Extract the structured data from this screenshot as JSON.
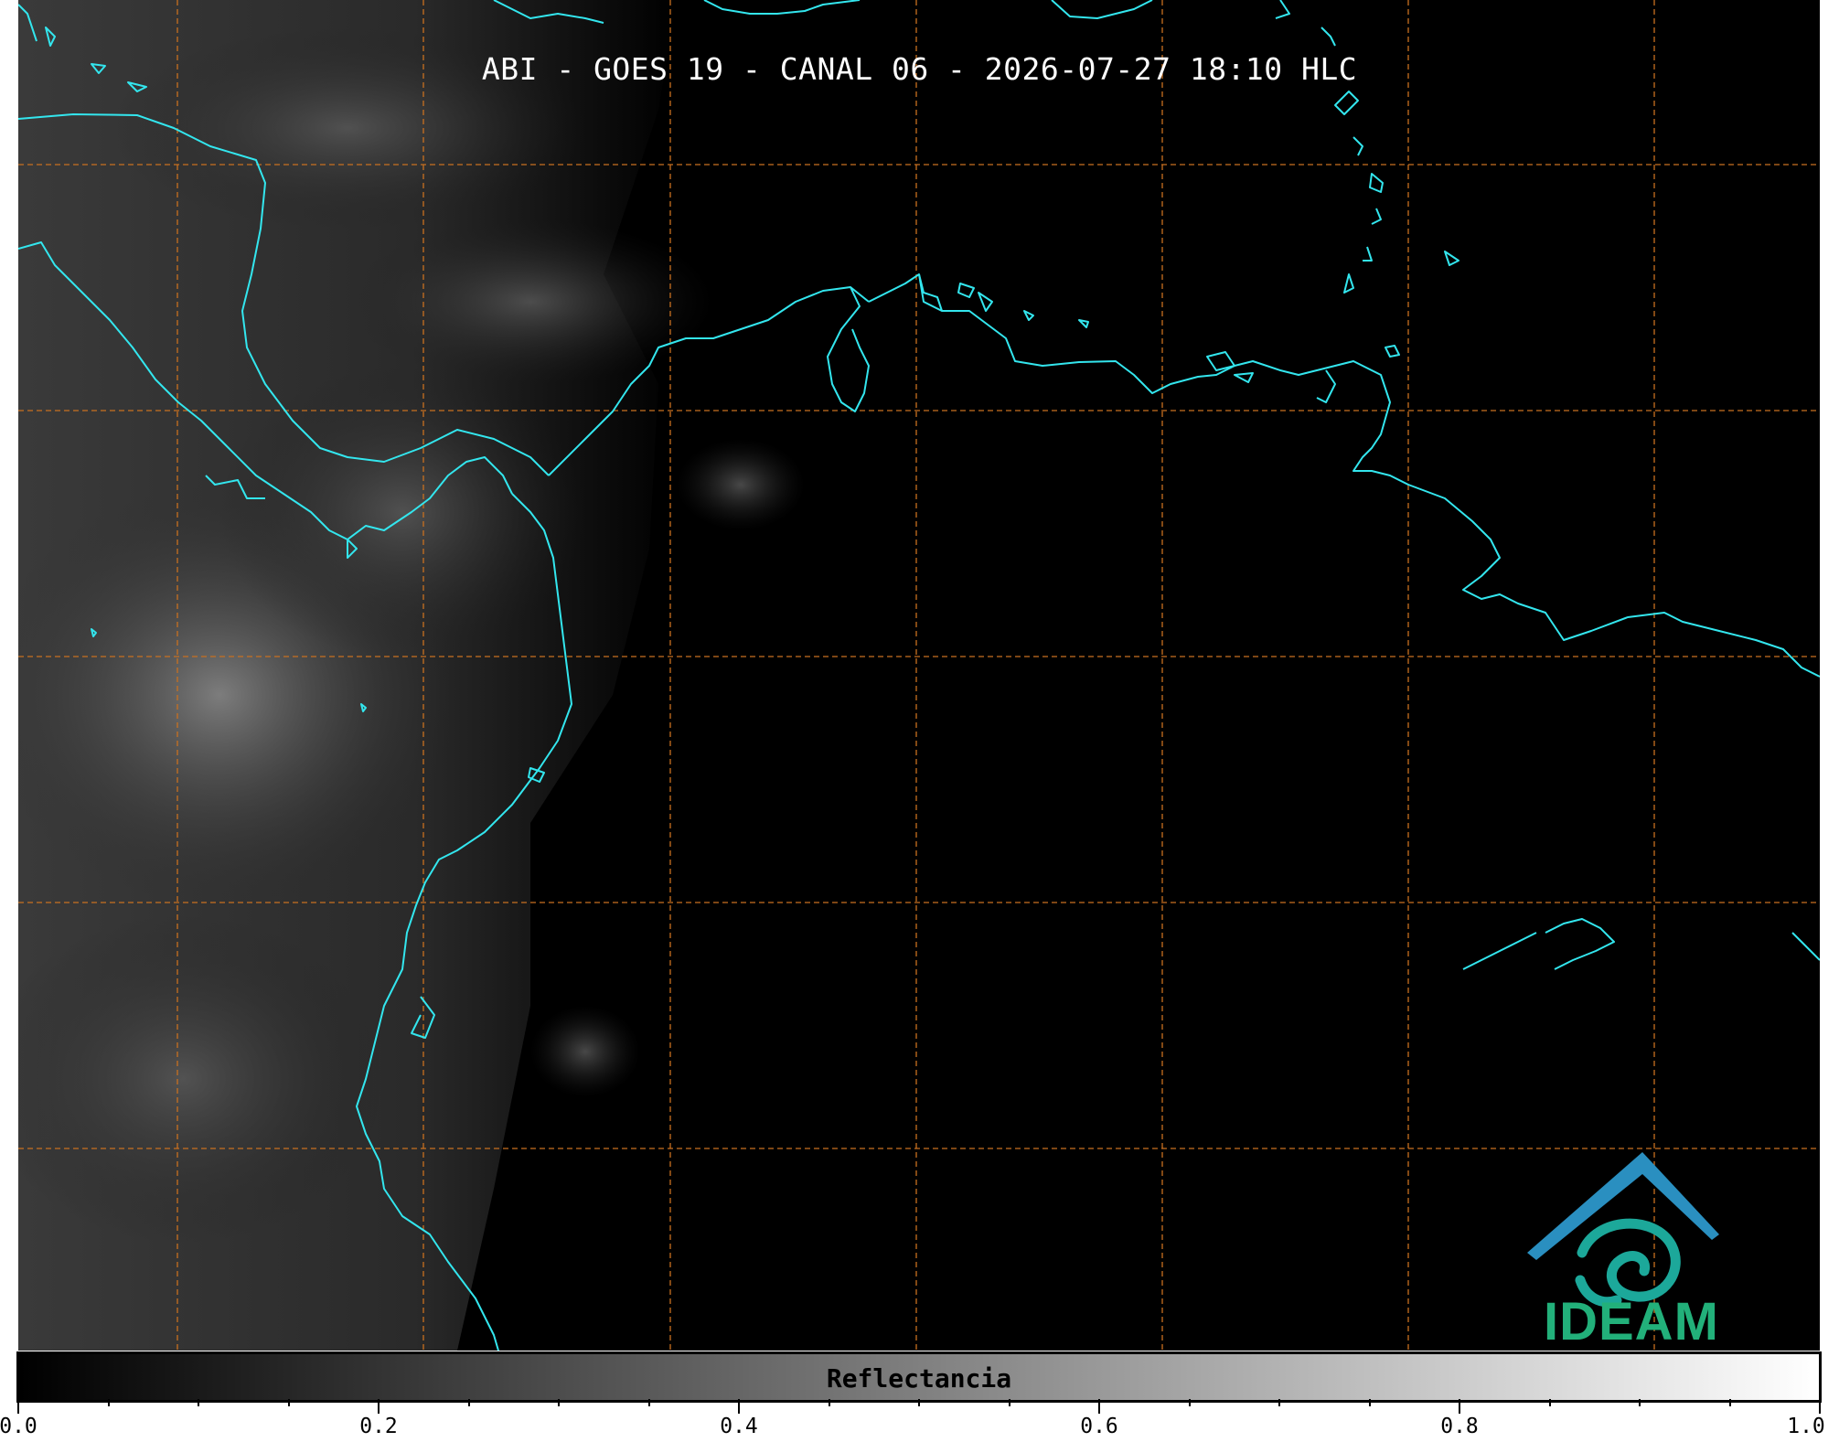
{
  "title": "ABI - GOES 19 - CANAL 06 - 2026-07-27 18:10 HLC",
  "colorbar": {
    "label": "Reflectancia",
    "ticks": [
      "0.0",
      "0.2",
      "0.4",
      "0.6",
      "0.8",
      "1.0"
    ],
    "min": 0.0,
    "max": 1.0,
    "colormap": "grayscale"
  },
  "logo": {
    "text": "IDEAM",
    "text_color": "#22b07a",
    "roof_color": "#2a8fc0",
    "swirl_color": "#1ca89a"
  },
  "colors": {
    "coastline": "#33e6ee",
    "gridlines": "#c87020",
    "background": "#000000"
  }
}
